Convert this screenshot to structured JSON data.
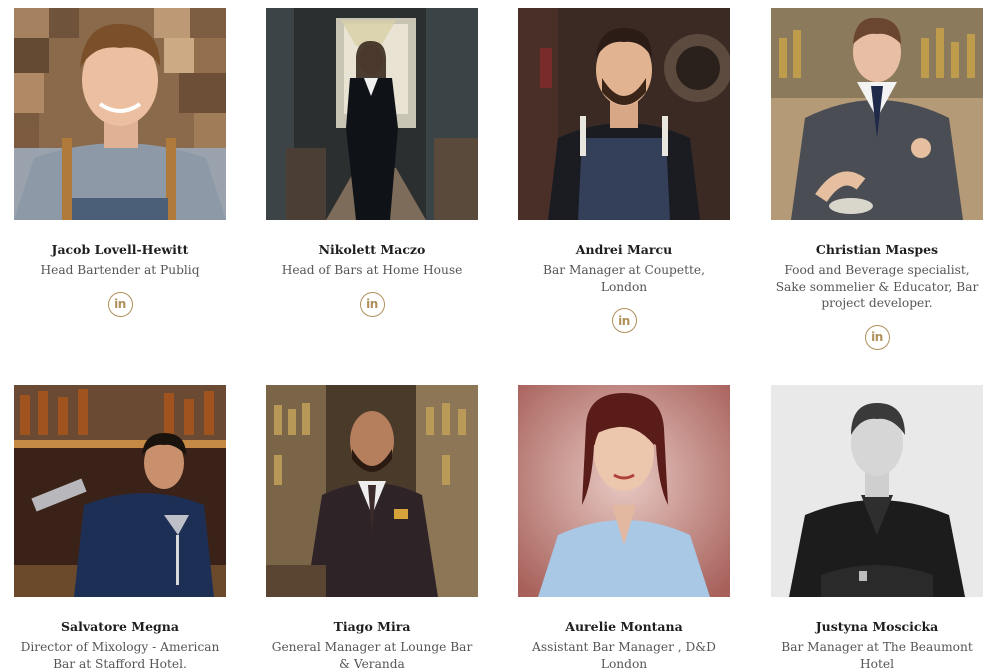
{
  "colors": {
    "accent": "#b0905a",
    "name_text": "#1e1e1e",
    "role_text": "#555555"
  },
  "team": [
    {
      "name": "Jacob Lovell-Hewitt",
      "role": "Head Bartender at Publiq",
      "icon": "linkedin-icon",
      "linkedin_label": "in"
    },
    {
      "name": "Nikolett Maczo",
      "role": "Head of Bars at Home House",
      "icon": "linkedin-icon",
      "linkedin_label": "in"
    },
    {
      "name": "Andrei Marcu",
      "role": "Bar Manager at Coupette, London",
      "icon": "linkedin-icon",
      "linkedin_label": "in"
    },
    {
      "name": "Christian Maspes",
      "role": "Food and Beverage specialist, Sake sommelier & Educator, Bar project developer.",
      "icon": "linkedin-icon",
      "linkedin_label": "in"
    },
    {
      "name": "Salvatore Megna",
      "role": "Director of Mixology - American Bar at Stafford Hotel."
    },
    {
      "name": "Tiago Mira",
      "role": "General Manager at Lounge Bar & Veranda"
    },
    {
      "name": "Aurelie Montana",
      "role": "Assistant Bar Manager , D&D London"
    },
    {
      "name": "Justyna Moscicka",
      "role": "Bar Manager at The Beaumont Hotel"
    }
  ]
}
